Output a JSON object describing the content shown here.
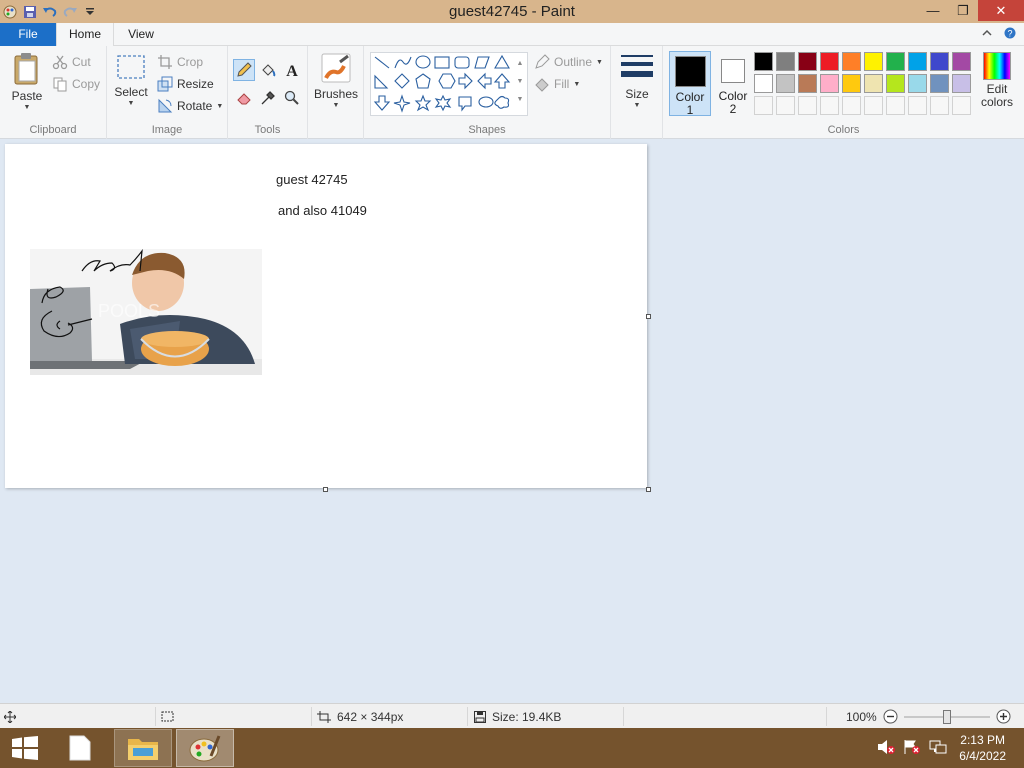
{
  "window": {
    "title": "guest42745 - Paint",
    "minimize_glyph": "—",
    "restore_glyph": "❐",
    "close_glyph": "✕"
  },
  "tabs": {
    "file": "File",
    "home": "Home",
    "view": "View"
  },
  "ribbon": {
    "clipboard": {
      "label": "Clipboard",
      "paste": "Paste",
      "cut": "Cut",
      "copy": "Copy"
    },
    "image": {
      "label": "Image",
      "select": "Select",
      "crop": "Crop",
      "resize": "Resize",
      "rotate": "Rotate"
    },
    "tools": {
      "label": "Tools"
    },
    "brushes": "Brushes",
    "shapes": {
      "label": "Shapes",
      "outline": "Outline",
      "fill": "Fill"
    },
    "size": "Size",
    "color1": {
      "line1": "Color",
      "line2": "1",
      "value": "#000000"
    },
    "color2": {
      "line1": "Color",
      "line2": "2",
      "value": "#ffffff"
    },
    "colors": {
      "label": "Colors",
      "row1": [
        "#000000",
        "#7f7f7f",
        "#880015",
        "#ed1c24",
        "#ff7f27",
        "#fff200",
        "#22b14c",
        "#00a2e8",
        "#3f48cc",
        "#a349a4"
      ],
      "row2": [
        "#ffffff",
        "#c3c3c3",
        "#b97a57",
        "#ffaec9",
        "#ffc90e",
        "#efe4b0",
        "#b5e61d",
        "#99d9ea",
        "#7092be",
        "#c8bfe7"
      ],
      "edit_line1": "Edit",
      "edit_line2": "colors"
    }
  },
  "canvas": {
    "text1": "guest 42745",
    "text2": "and also 41049",
    "scribble_text": "7Ko"
  },
  "statusbar": {
    "dimensions": "642 × 344px",
    "size": "Size: 19.4KB",
    "zoom": "100%",
    "zoom_level": 0.5
  },
  "taskbar": {
    "time": "2:13 PM",
    "date": "6/4/2022"
  }
}
